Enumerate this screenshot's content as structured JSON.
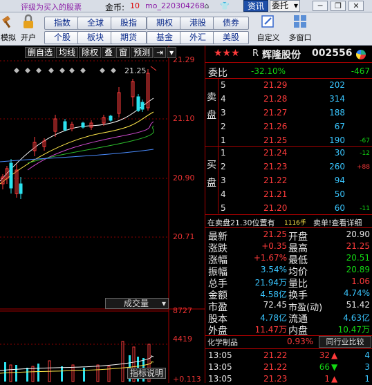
{
  "topbar": {
    "note": "评级为买入的股票",
    "coin_label": "金币:",
    "coin_value": "10",
    "user": "mo_220304268",
    "news_button": "资讯",
    "select_value": "委托",
    "select_arrow": "▾"
  },
  "toolbar": {
    "left_tools": [
      {
        "label": "模拟",
        "icon": "gavel-icon"
      },
      {
        "label": "开户",
        "icon": "lock-icon"
      }
    ],
    "quick_row1": [
      "指数",
      "全球",
      "股指",
      "期权",
      "港股",
      "债券"
    ],
    "quick_row2": [
      "个股",
      "板块",
      "期货",
      "基金",
      "外汇",
      "美股"
    ],
    "right_tools": [
      {
        "label": "自定义",
        "icon": "custom-icon"
      },
      {
        "label": "多窗口",
        "icon": "multiwindow-icon"
      }
    ]
  },
  "chart": {
    "toolbar": [
      "删自选",
      "均线",
      "除权",
      "叠",
      "窗",
      "预测"
    ],
    "price_ticks": [
      "21.29",
      "21.10",
      "20.90",
      "20.71"
    ],
    "high_marker": "21.25",
    "volume_label": "成交量",
    "volume_ticks": [
      "8727",
      "4419",
      "+0.113"
    ],
    "indicator_button": "指标说明"
  },
  "quote": {
    "stars": "★★★",
    "tag": "R",
    "name": "辉隆股份",
    "code": "002556",
    "webi_label": "委比",
    "webi_value": "-32.10%",
    "webi_diff": "-467",
    "sell_label": "卖盘",
    "buy_label": "买盘",
    "sells": [
      {
        "level": "5",
        "price": "21.29",
        "vol": "202",
        "chg": ""
      },
      {
        "level": "4",
        "price": "21.28",
        "vol": "314",
        "chg": ""
      },
      {
        "level": "3",
        "price": "21.27",
        "vol": "188",
        "chg": ""
      },
      {
        "level": "2",
        "price": "21.26",
        "vol": "67",
        "chg": ""
      },
      {
        "level": "1",
        "price": "21.25",
        "vol": "190",
        "chg": "-67"
      }
    ],
    "buys": [
      {
        "level": "1",
        "price": "21.24",
        "vol": "30",
        "chg": "-12"
      },
      {
        "level": "2",
        "price": "21.23",
        "vol": "260",
        "chg": "+88"
      },
      {
        "level": "3",
        "price": "21.22",
        "vol": "94",
        "chg": ""
      },
      {
        "level": "4",
        "price": "21.21",
        "vol": "50",
        "chg": ""
      },
      {
        "level": "5",
        "price": "21.20",
        "vol": "60",
        "chg": "-11"
      }
    ],
    "notice": "在卖盘21.30位置有",
    "notice_count": "1116手",
    "notice_tail": "卖单!查看详细",
    "stats": [
      {
        "l1": "最新",
        "v1": "21.25",
        "l2": "开盘",
        "v2": "20.90"
      },
      {
        "l1": "涨跌",
        "v1": "+0.35",
        "l2": "最高",
        "v2": "21.25"
      },
      {
        "l1": "涨幅",
        "v1": "+1.67%",
        "l2": "最低",
        "v2": "20.51"
      },
      {
        "l1": "振幅",
        "v1": "3.54%",
        "l2": "均价",
        "v2": "20.89"
      },
      {
        "l1": "总手",
        "v1": "21.94万",
        "l2": "量比",
        "v2": "1.06"
      },
      {
        "l1": "金额",
        "v1": "4.58亿",
        "l2": "换手",
        "v2": "4.74%"
      },
      {
        "l1": "市盈",
        "v1": "72.45",
        "l2": "市盈(动)",
        "v2": "51.42"
      },
      {
        "l1": "股本",
        "v1": "4.78亿",
        "l2": "流通",
        "v2": "4.63亿"
      },
      {
        "l1": "外盘",
        "v1": "11.47万",
        "l2": "内盘",
        "v2": "10.47万"
      }
    ],
    "industry_name": "化学制品",
    "industry_pct": "0.93%",
    "compare_button": "同行业比较",
    "ticks": [
      {
        "time": "13:05",
        "price": "21.22",
        "vol": "32",
        "dir": "up",
        "num": "4"
      },
      {
        "time": "13:05",
        "price": "21.22",
        "vol": "66",
        "dir": "down",
        "num": "3"
      },
      {
        "time": "13:05",
        "price": "21.23",
        "vol": "1",
        "dir": "up",
        "num": "1"
      }
    ]
  }
}
